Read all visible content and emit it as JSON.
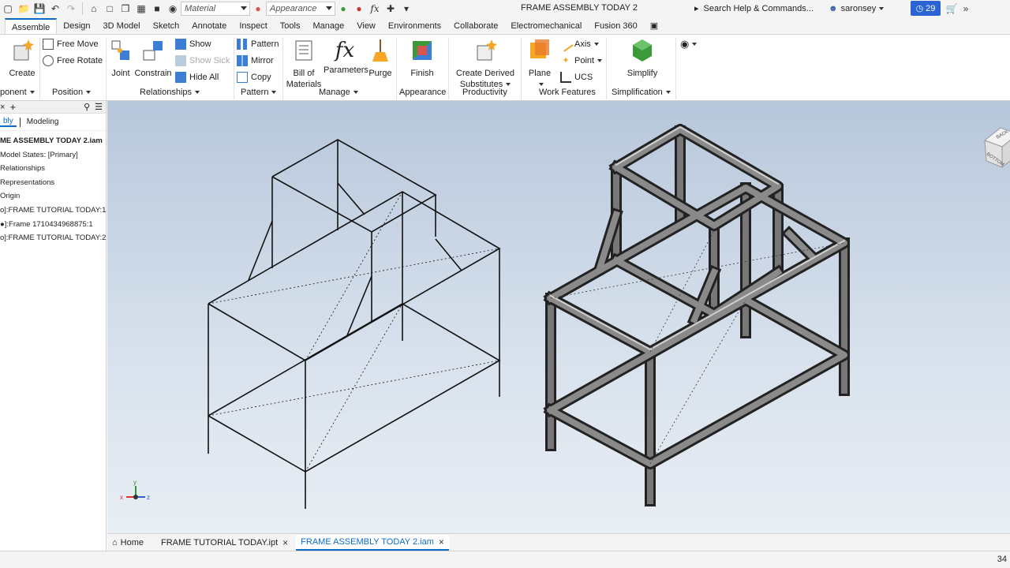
{
  "quick_access": {
    "material_placeholder": "Material",
    "appearance_placeholder": "Appearance",
    "fx_label": "fx"
  },
  "title": "FRAME ASSEMBLY TODAY 2",
  "search": {
    "placeholder": "Search Help & Commands..."
  },
  "user": {
    "name": "saronsey"
  },
  "notifications": {
    "count": "29"
  },
  "tabs": [
    "Assemble",
    "Design",
    "3D Model",
    "Sketch",
    "Annotate",
    "Inspect",
    "Tools",
    "Manage",
    "View",
    "Environments",
    "Collaborate",
    "Electromechanical",
    "Fusion 360"
  ],
  "ribbon": {
    "component": {
      "create_label": "Create",
      "group_label": "ponent"
    },
    "position": {
      "free_move": "Free Move",
      "free_rotate": "Free Rotate",
      "group_label": "Position"
    },
    "relationships": {
      "joint": "Joint",
      "constrain": "Constrain",
      "show": "Show",
      "show_sick": "Show Sick",
      "hide_all": "Hide All",
      "group_label": "Relationships"
    },
    "pattern": {
      "pattern": "Pattern",
      "mirror": "Mirror",
      "copy": "Copy",
      "group_label": "Pattern"
    },
    "manage": {
      "bom_line1": "Bill of",
      "bom_line2": "Materials",
      "parameters": "Parameters",
      "purge": "Purge",
      "fx": "fx",
      "group_label": "Manage"
    },
    "appearance": {
      "finish": "Finish",
      "group_label": "Appearance"
    },
    "productivity": {
      "derived_line1": "Create Derived",
      "derived_line2": "Substitutes",
      "group_label": "Productivity"
    },
    "work_features": {
      "plane": "Plane",
      "axis": "Axis",
      "point": "Point",
      "ucs": "UCS",
      "group_label": "Work Features"
    },
    "simplification": {
      "simplify": "Simplify",
      "group_label": "Simplification"
    }
  },
  "browser": {
    "tabs": [
      "bly",
      "Modeling"
    ],
    "tree": [
      "ME ASSEMBLY TODAY 2.iam",
      "Model States: [Primary]",
      "Relationships",
      "Representations",
      "Origin",
      "o]:FRAME TUTORIAL TODAY:1",
      "●]:Frame 1710434968875:1",
      "o]:FRAME TUTORIAL TODAY:2"
    ]
  },
  "viewcube": {
    "back": "BACK",
    "bottom": "BOTTOM"
  },
  "axis_triad": {
    "x": "x",
    "y": "y",
    "z": "z"
  },
  "doc_tabs": {
    "home": "Home",
    "doc1": "FRAME TUTORIAL TODAY.ipt",
    "doc2": "FRAME ASSEMBLY TODAY 2.iam"
  },
  "status": {
    "count": "34"
  },
  "colors": {
    "accent": "#0b6cc6",
    "badge": "#2a63d4"
  }
}
